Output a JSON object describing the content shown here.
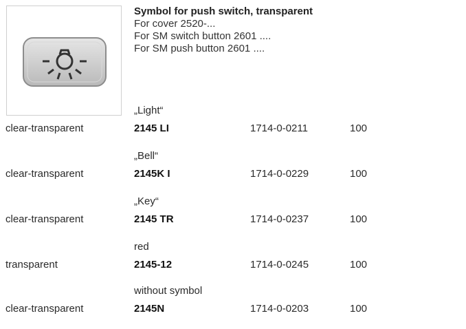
{
  "product": {
    "title": "Symbol for push switch, transparent",
    "lines": [
      "For cover 2520-...",
      "For SM switch button 2601 ....",
      "For SM push button 2601 ...."
    ],
    "image_icon": "light-bulb-symbol-icon"
  },
  "rows": [
    {
      "variant": "„Light“",
      "material": "clear-transparent",
      "article": "2145 LI",
      "code": "1714-0-0211",
      "qty": "100"
    },
    {
      "variant": "„Bell“",
      "material": "clear-transparent",
      "article": "2145K I",
      "code": "1714-0-0229",
      "qty": "100"
    },
    {
      "variant": "„Key“",
      "material": "clear-transparent",
      "article": "2145 TR",
      "code": "1714-0-0237",
      "qty": "100"
    },
    {
      "variant": "red",
      "material": "transparent",
      "article": "2145-12",
      "code": "1714-0-0245",
      "qty": "100"
    },
    {
      "variant": "without symbol",
      "material": "clear-transparent",
      "article": "2145N",
      "code": "1714-0-0203",
      "qty": "100"
    }
  ]
}
